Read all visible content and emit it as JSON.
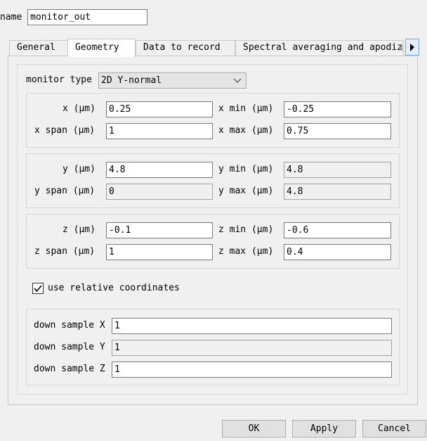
{
  "name_field": {
    "label": "name",
    "value": "monitor_out"
  },
  "tabs": [
    {
      "label": "General"
    },
    {
      "label": "Geometry"
    },
    {
      "label": "Data to record"
    },
    {
      "label": "Spectral averaging and apodizat"
    }
  ],
  "monitor_type": {
    "label": "monitor type",
    "value": "2D Y-normal"
  },
  "x_group": {
    "x_label": "x (μm)",
    "x_value": "0.25",
    "xmin_label": "x min (μm)",
    "xmin_value": "-0.25",
    "xspan_label": "x span (μm)",
    "xspan_value": "1",
    "xmax_label": "x max (μm)",
    "xmax_value": "0.75"
  },
  "y_group": {
    "y_label": "y (μm)",
    "y_value": "4.8",
    "ymin_label": "y min (μm)",
    "ymin_value": "4.8",
    "yspan_label": "y span (μm)",
    "yspan_value": "0",
    "ymax_label": "y max (μm)",
    "ymax_value": "4.8"
  },
  "z_group": {
    "z_label": "z (μm)",
    "z_value": "-0.1",
    "zmin_label": "z min (μm)",
    "zmin_value": "-0.6",
    "zspan_label": "z span (μm)",
    "zspan_value": "1",
    "zmax_label": "z max (μm)",
    "zmax_value": "0.4"
  },
  "relative_coords": {
    "label": "use relative coordinates",
    "checked": true
  },
  "downsample": {
    "x_label": "down sample X",
    "x_value": "1",
    "y_label": "down sample Y",
    "y_value": "1",
    "z_label": "down sample Z",
    "z_value": "1"
  },
  "buttons": {
    "ok": "OK",
    "apply": "Apply",
    "cancel": "Cancel"
  }
}
